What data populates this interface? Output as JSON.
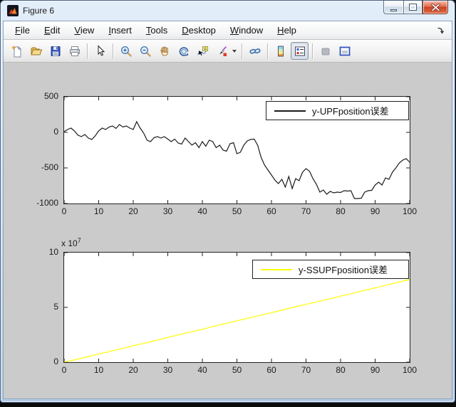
{
  "window": {
    "title": "Figure 6"
  },
  "menu": {
    "items": [
      {
        "label": "File"
      },
      {
        "label": "Edit"
      },
      {
        "label": "View"
      },
      {
        "label": "Insert"
      },
      {
        "label": "Tools"
      },
      {
        "label": "Desktop"
      },
      {
        "label": "Window"
      },
      {
        "label": "Help"
      }
    ]
  },
  "toolbar": {
    "buttons": [
      "new-figure",
      "open-file",
      "save-figure",
      "print-figure",
      "edit-plot-pointer",
      "zoom-in",
      "zoom-out",
      "pan-hand",
      "rotate-3d",
      "data-cursor",
      "brush-data",
      "link-plot",
      "insert-colorbar",
      "insert-legend",
      "hide-plot-tools",
      "show-plot-tools"
    ],
    "pressed": "insert-legend"
  },
  "colors": {
    "figure_bg": "#cbcbcb",
    "axes_bg": "#ffffff",
    "upf_line": "#1a1a1a",
    "ssupf_line": "#ffff00"
  },
  "chart_data": [
    {
      "type": "line",
      "title": "",
      "xlabel": "",
      "ylabel": "",
      "xlim": [
        0,
        100
      ],
      "ylim": [
        -1000,
        500
      ],
      "xticks": [
        0,
        10,
        20,
        30,
        40,
        50,
        60,
        70,
        80,
        90,
        100
      ],
      "yticks": [
        500,
        0,
        -500,
        -1000
      ],
      "ytick_labels": [
        "500",
        "0",
        "-500",
        "-1000"
      ],
      "grid": false,
      "legend": {
        "label": "y-UPFposition误差",
        "line_color": "#1a1a1a",
        "position": "northeast"
      },
      "series": [
        {
          "name": "y-UPFposition误差",
          "color": "#1a1a1a",
          "x_start": 0,
          "x_step": 1,
          "values": [
            10,
            40,
            60,
            20,
            -40,
            -60,
            -30,
            -80,
            -100,
            -50,
            20,
            60,
            40,
            75,
            90,
            55,
            110,
            75,
            90,
            60,
            40,
            150,
            60,
            -10,
            -110,
            -130,
            -75,
            -60,
            -80,
            -60,
            -95,
            -130,
            -95,
            -150,
            -165,
            -80,
            -130,
            -180,
            -145,
            -215,
            -130,
            -195,
            -110,
            -130,
            -215,
            -180,
            -250,
            -265,
            -160,
            -145,
            -300,
            -280,
            -180,
            -120,
            -100,
            -95,
            -180,
            -350,
            -460,
            -530,
            -600,
            -670,
            -720,
            -660,
            -770,
            -620,
            -790,
            -650,
            -680,
            -560,
            -510,
            -545,
            -650,
            -730,
            -840,
            -810,
            -870,
            -830,
            -850,
            -840,
            -845,
            -820,
            -825,
            -820,
            -930,
            -930,
            -925,
            -840,
            -820,
            -815,
            -740,
            -700,
            -740,
            -640,
            -660,
            -560,
            -500,
            -430,
            -390,
            -370,
            -420
          ]
        }
      ]
    },
    {
      "type": "line",
      "title": "",
      "xlabel": "",
      "ylabel": "",
      "xlim": [
        0,
        100
      ],
      "ylim": [
        0,
        100000000
      ],
      "xticks": [
        0,
        10,
        20,
        30,
        40,
        50,
        60,
        70,
        80,
        90,
        100
      ],
      "yticks": [
        100000000,
        50000000,
        0
      ],
      "ytick_labels": [
        "10",
        "5",
        "0"
      ],
      "y_multiplier": {
        "base": "x 10",
        "exp": "7"
      },
      "grid": false,
      "legend": {
        "label": "y-SSUPFposition误差",
        "line_color": "#ffff00",
        "position": "northeast"
      },
      "series": [
        {
          "name": "y-SSUPFposition误差",
          "color": "#ffff00",
          "x_start": 0,
          "x_step": 5,
          "values": [
            0,
            3600000,
            7400000,
            11200000,
            15000000,
            18600000,
            22600000,
            26400000,
            30000000,
            34000000,
            37800000,
            41400000,
            45200000,
            49000000,
            52800000,
            56400000,
            60200000,
            64000000,
            67800000,
            71600000,
            75500000
          ]
        }
      ]
    }
  ]
}
